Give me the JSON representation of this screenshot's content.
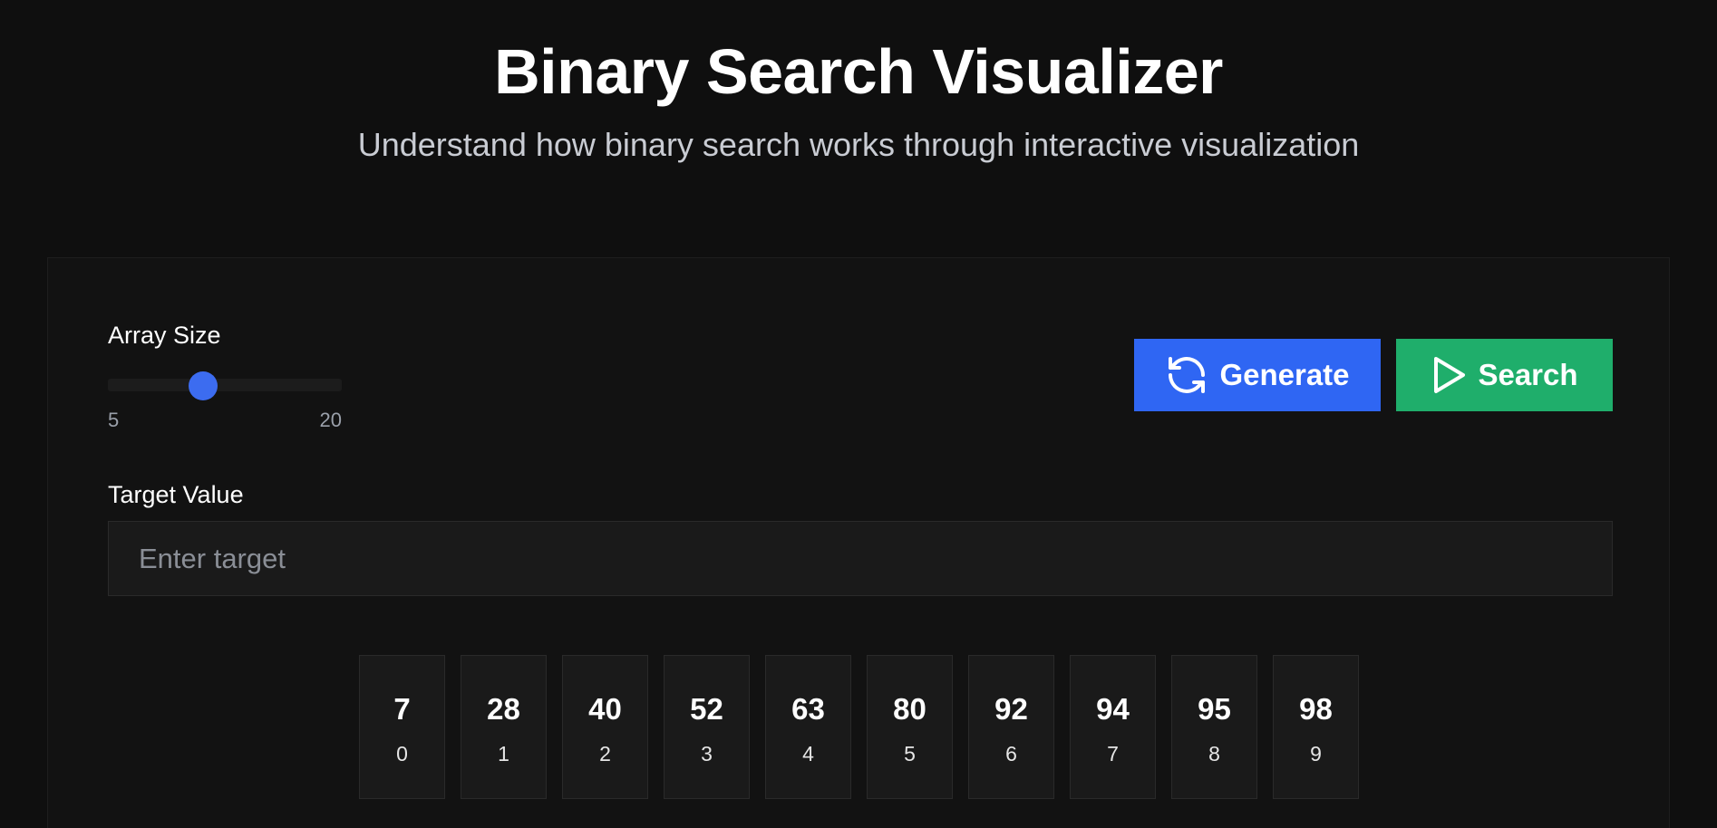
{
  "header": {
    "title": "Binary Search Visualizer",
    "subtitle": "Understand how binary search works through interactive visualization"
  },
  "controls": {
    "array_size": {
      "label": "Array Size",
      "min_label": "5",
      "max_label": "20",
      "min": 5,
      "max": 20,
      "value": 10
    },
    "generate_button": {
      "label": "Generate",
      "icon": "refresh-icon",
      "color": "#2f66f3"
    },
    "search_button": {
      "label": "Search",
      "icon": "play-icon",
      "color": "#1fae6b"
    },
    "target": {
      "label": "Target Value",
      "placeholder": "Enter target",
      "value": ""
    }
  },
  "array": {
    "values": [
      "7",
      "28",
      "40",
      "52",
      "63",
      "80",
      "92",
      "94",
      "95",
      "98"
    ],
    "indices": [
      "0",
      "1",
      "2",
      "3",
      "4",
      "5",
      "6",
      "7",
      "8",
      "9"
    ]
  },
  "colors": {
    "background": "#0f0f0f",
    "panel": "#121212",
    "accent_blue": "#2f66f3",
    "accent_green": "#1fae6b",
    "slider_thumb": "#3c6cf0"
  }
}
